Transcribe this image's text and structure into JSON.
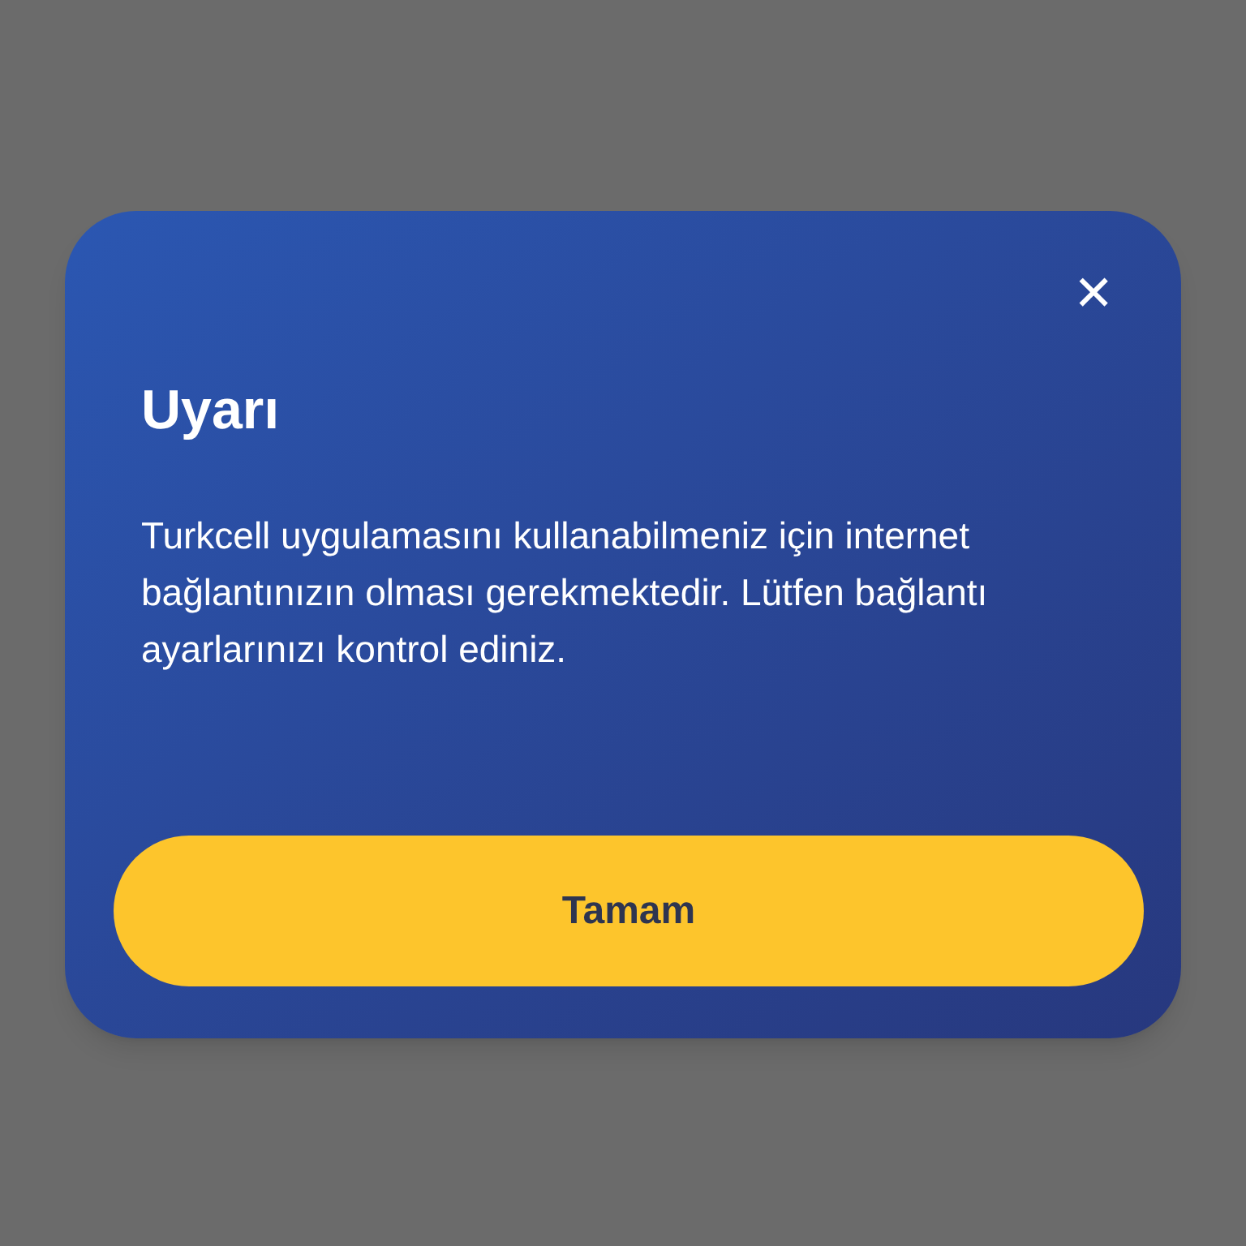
{
  "dialog": {
    "close_label": "✕",
    "title": "Uyarı",
    "message": "Turkcell uygulamasını kullanabilmeniz için internet bağlantınızın olması gerekmektedir. Lütfen bağlantı ayarlarınızı kontrol ediniz.",
    "buttons": [
      "Tamam"
    ]
  }
}
